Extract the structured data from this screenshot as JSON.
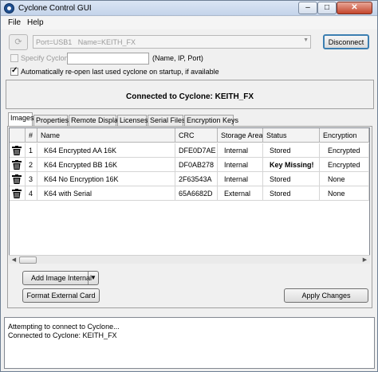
{
  "window": {
    "title": "Cyclone Control GUI",
    "minimize": "–",
    "maximize": "□",
    "close": "✕"
  },
  "menu": [
    "File",
    "Help"
  ],
  "connection": {
    "port_value": "Port=USB1   Name=KEITH_FX",
    "disconnect_label": "Disconnect",
    "specify_label": "Specify Cyclone",
    "specify_value": "",
    "specify_hint": "(Name, IP, Port)",
    "specify_checked": false,
    "auto_reopen_label": "Automatically re-open last used cyclone on startup, if available",
    "auto_reopen_checked": true
  },
  "status_banner": "Connected to Cyclone: KEITH_FX",
  "tabs": [
    {
      "label": "Images",
      "active": true
    },
    {
      "label": "Properties",
      "active": false
    },
    {
      "label": "Remote Display",
      "active": false
    },
    {
      "label": "Licenses",
      "active": false
    },
    {
      "label": "Serial Files",
      "active": false
    },
    {
      "label": "Encryption Keys",
      "active": false
    }
  ],
  "images_table": {
    "columns": [
      "#",
      "Name",
      "CRC",
      "Storage Area",
      "Status",
      "Encryption"
    ],
    "rows": [
      {
        "num": "1",
        "name": "K64 Encrypted AA 16K",
        "crc": "DFE0D7AE",
        "storage": "Internal",
        "status": "Stored",
        "status_bold": false,
        "encryption": "Encrypted"
      },
      {
        "num": "2",
        "name": "K64 Encrypted BB 16K",
        "crc": "DF0AB278",
        "storage": "Internal",
        "status": "Key Missing!",
        "status_bold": true,
        "encryption": "Encrypted"
      },
      {
        "num": "3",
        "name": "K64 No Encryption 16K",
        "crc": "2F63543A",
        "storage": "Internal",
        "status": "Stored",
        "status_bold": false,
        "encryption": "None"
      },
      {
        "num": "4",
        "name": "K64 with Serial",
        "crc": "65A6682D",
        "storage": "External",
        "status": "Stored",
        "status_bold": false,
        "encryption": "None"
      }
    ]
  },
  "buttons": {
    "add_image": "Add Image Internal",
    "format_card": "Format External Card",
    "apply": "Apply Changes"
  },
  "log": [
    "Attempting to connect to Cyclone...",
    "Connected to Cyclone: KEITH_FX"
  ],
  "colors": {
    "window_bg": "#f0f0f0",
    "title_gradient_top": "#dbe6f4",
    "close_red": "#c4452c"
  }
}
